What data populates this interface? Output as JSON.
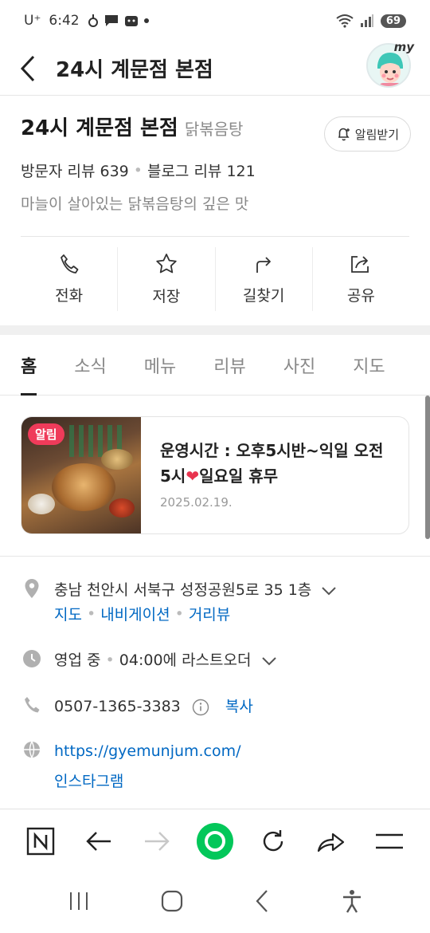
{
  "status_bar": {
    "carrier": "U⁺",
    "time": "6:42",
    "battery": "69"
  },
  "header": {
    "title": "24시 계문점 본점",
    "my_badge": "my"
  },
  "place": {
    "name": "24시 계문점 본점",
    "category": "닭볶음탕",
    "alarm_label": "알림받기",
    "visitor_reviews": "방문자 리뷰 639",
    "blog_reviews": "블로그 리뷰 121",
    "description": "마늘이 살아있는 닭볶음탕의 깊은 맛"
  },
  "actions": [
    {
      "label": "전화",
      "icon": "phone-icon"
    },
    {
      "label": "저장",
      "icon": "star-icon"
    },
    {
      "label": "길찾기",
      "icon": "directions-icon"
    },
    {
      "label": "공유",
      "icon": "share-icon"
    }
  ],
  "tabs": [
    "홈",
    "소식",
    "메뉴",
    "리뷰",
    "사진",
    "지도"
  ],
  "notice": {
    "badge": "알림",
    "text_part1": "운영시간 : 오후5시반~익일 오전5시",
    "heart": "❤",
    "text_part2": "일요일 휴무",
    "date": "2025.02.19."
  },
  "info": {
    "address": "충남 천안시 서북구 성정공원5로 35 1층",
    "address_links": [
      "지도",
      "내비게이션",
      "거리뷰"
    ],
    "status": "영업 중",
    "last_order": "04:00에 라스트오더",
    "phone": "0507-1365-3383",
    "copy_label": "복사",
    "website": "https://gyemunjum.com/",
    "instagram": "인스타그램"
  },
  "colors": {
    "accent_green": "#03c75a",
    "link_blue": "#0068c3",
    "badge_red": "#ef3b5a"
  }
}
